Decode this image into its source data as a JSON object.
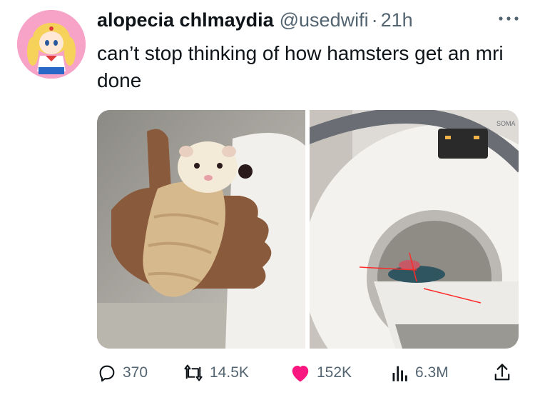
{
  "tweet": {
    "display_name": "alopecia chlmaydia",
    "handle": "@usedwifi",
    "separator": "·",
    "time": "21h",
    "text": "can’t stop thinking of how hamsters get an mri done"
  },
  "media": [
    {
      "icon": "hamster-wrapped-photo"
    },
    {
      "icon": "mri-scanner-photo",
      "brand_text": "SOMA"
    }
  ],
  "actions": {
    "replies": "370",
    "retweets": "14.5K",
    "likes": "152K",
    "views": "6.3M"
  },
  "colors": {
    "text": "#0f1419",
    "secondary": "#536471",
    "like": "#f91880",
    "avatar_bg": "#f7a3c8"
  }
}
